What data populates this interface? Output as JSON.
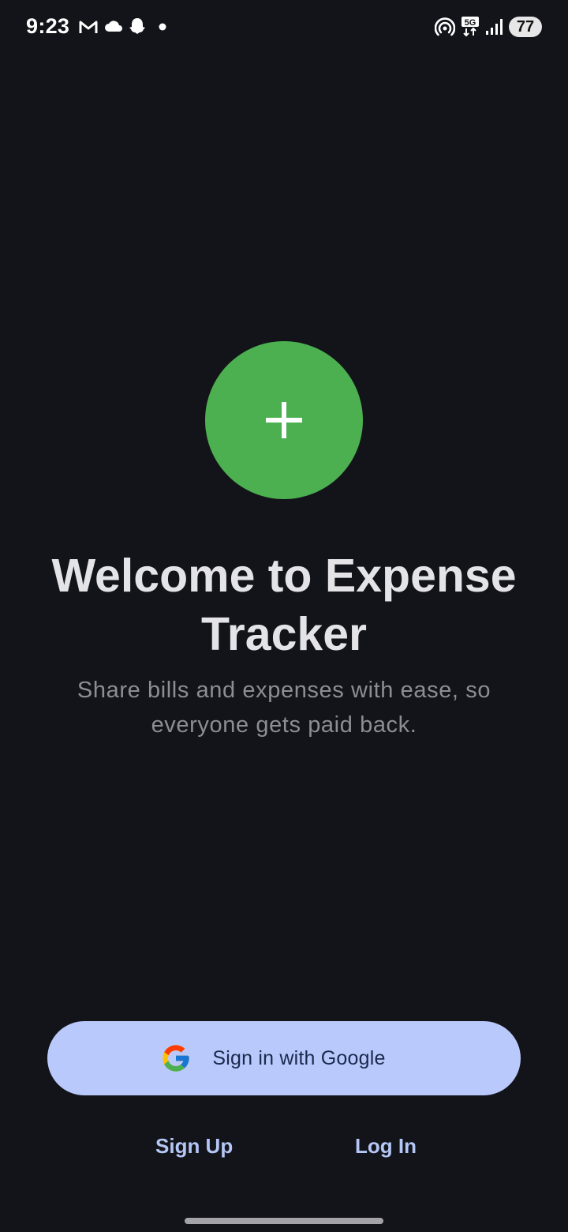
{
  "status_bar": {
    "time": "9:23",
    "battery": "77",
    "icons": [
      "gmail-icon",
      "cloud-icon",
      "snapchat-icon",
      "notification-dot-icon",
      "hotspot-icon",
      "5g-icon",
      "signal-icon",
      "battery-icon"
    ]
  },
  "hero": {
    "logo_icon": "plus-icon",
    "title": "Welcome to Expense Tracker",
    "subtitle": "Share bills and expenses with ease, so everyone gets paid back."
  },
  "actions": {
    "google_label": "Sign in with Google",
    "signup_label": "Sign Up",
    "login_label": "Log In"
  },
  "colors": {
    "background": "#131419",
    "accent_green": "#4caf50",
    "google_button": "#b9c9fb",
    "link": "#b3c6f5"
  }
}
